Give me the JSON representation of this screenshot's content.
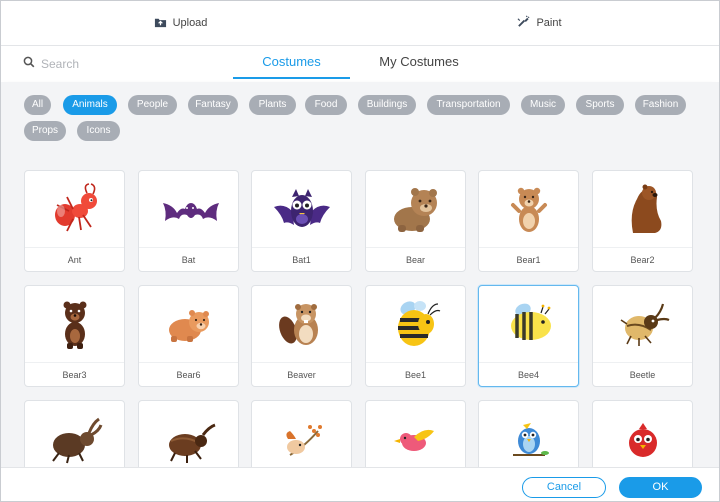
{
  "toolbar": {
    "upload_label": "Upload",
    "paint_label": "Paint"
  },
  "search": {
    "placeholder": "Search"
  },
  "tabs": [
    {
      "label": "Costumes",
      "active": true
    },
    {
      "label": "My Costumes",
      "active": false
    }
  ],
  "filters": [
    {
      "label": "All",
      "active": false
    },
    {
      "label": "Animals",
      "active": true
    },
    {
      "label": "People",
      "active": false
    },
    {
      "label": "Fantasy",
      "active": false
    },
    {
      "label": "Plants",
      "active": false
    },
    {
      "label": "Food",
      "active": false
    },
    {
      "label": "Buildings",
      "active": false
    },
    {
      "label": "Transportation",
      "active": false
    },
    {
      "label": "Music",
      "active": false
    },
    {
      "label": "Sports",
      "active": false
    },
    {
      "label": "Fashion",
      "active": false
    },
    {
      "label": "Props",
      "active": false
    },
    {
      "label": "Icons",
      "active": false
    }
  ],
  "costumes": [
    {
      "label": "Ant",
      "icon": "ant-icon",
      "selected": false
    },
    {
      "label": "Bat",
      "icon": "bat-icon",
      "selected": false
    },
    {
      "label": "Bat1",
      "icon": "bat1-icon",
      "selected": false
    },
    {
      "label": "Bear",
      "icon": "bear-icon",
      "selected": false
    },
    {
      "label": "Bear1",
      "icon": "bear1-icon",
      "selected": false
    },
    {
      "label": "Bear2",
      "icon": "bear2-icon",
      "selected": false
    },
    {
      "label": "Bear3",
      "icon": "bear3-icon",
      "selected": false
    },
    {
      "label": "Bear6",
      "icon": "bear6-icon",
      "selected": false
    },
    {
      "label": "Beaver",
      "icon": "beaver-icon",
      "selected": false
    },
    {
      "label": "Bee1",
      "icon": "bee1-icon",
      "selected": false
    },
    {
      "label": "Bee4",
      "icon": "bee4-icon",
      "selected": true
    },
    {
      "label": "Beetle",
      "icon": "beetle-icon",
      "selected": false
    },
    {
      "label": "",
      "icon": "beetle-horned-icon",
      "selected": false
    },
    {
      "label": "",
      "icon": "beetle-brown-icon",
      "selected": false
    },
    {
      "label": "",
      "icon": "bird-branch-icon",
      "selected": false
    },
    {
      "label": "",
      "icon": "pink-bird-icon",
      "selected": false
    },
    {
      "label": "",
      "icon": "blue-bird-icon",
      "selected": false
    },
    {
      "label": "",
      "icon": "red-bird-icon",
      "selected": false
    }
  ],
  "footer": {
    "cancel_label": "Cancel",
    "ok_label": "OK"
  },
  "colors": {
    "accent": "#1a9be8",
    "chip": "#a8adb5",
    "panel_bg": "#f3f4f6"
  }
}
